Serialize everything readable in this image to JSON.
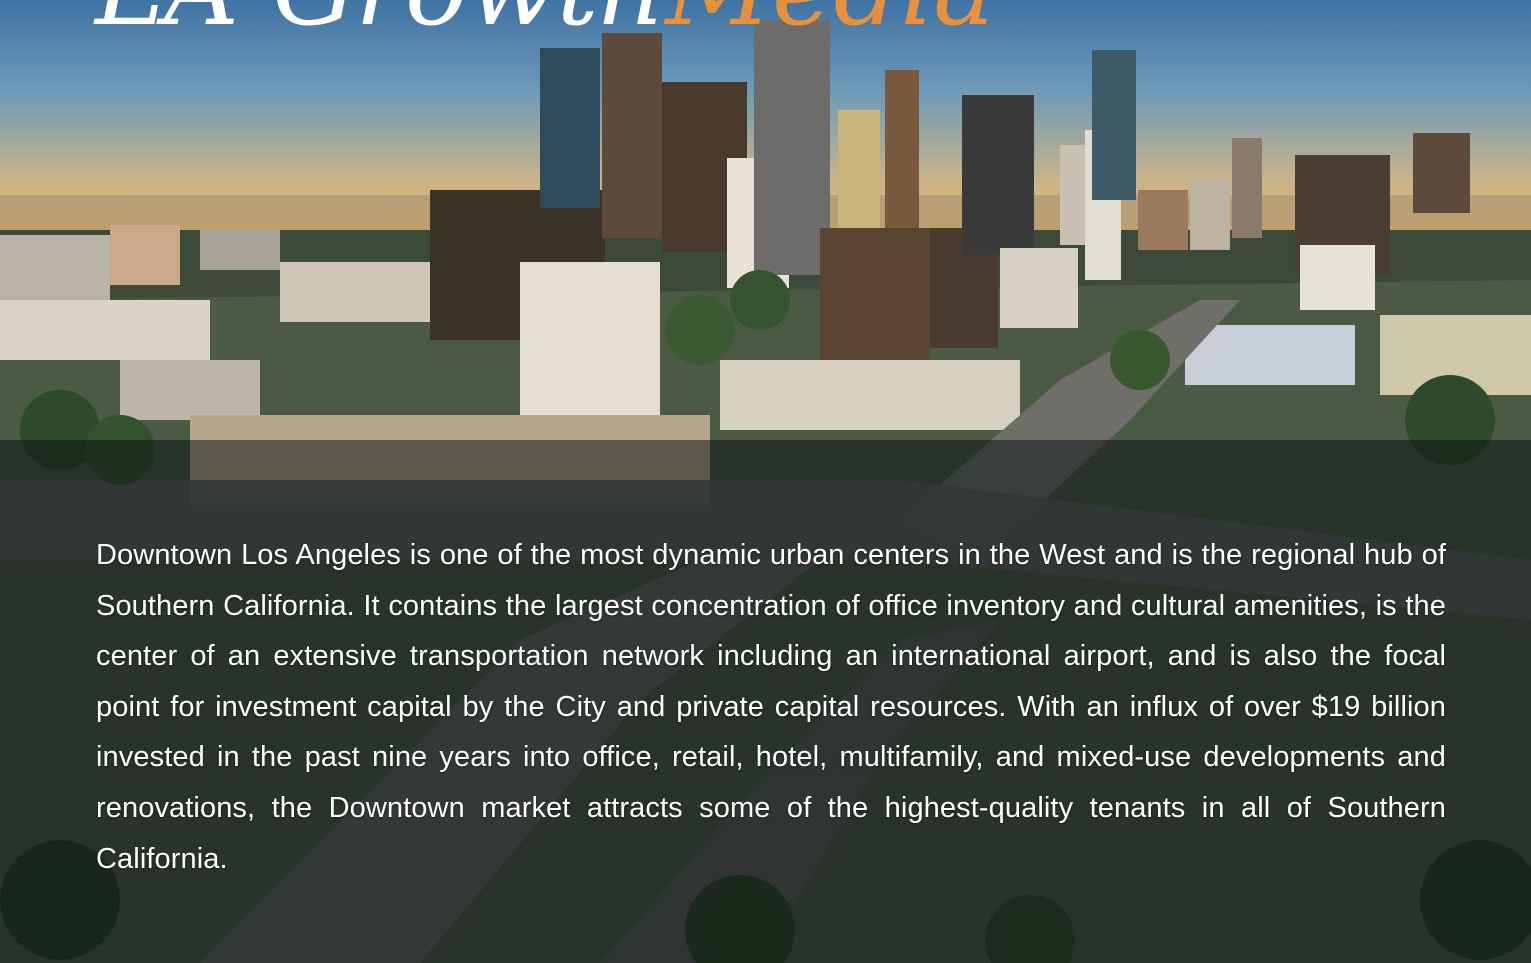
{
  "hero": {
    "image_icon": "downtown-los-angeles-aerial-photo",
    "title_white": "LA Growth",
    "title_accent": "Media",
    "accent_color": "#e8913c",
    "overlay_color": "rgba(10,18,20,0.52)"
  },
  "content": {
    "paragraph": "Downtown Los Angeles is one of the most dynamic urban centers in the West and is the regional hub of Southern California. It contains the largest concentration of office inventory and cultural amenities, is the center of an extensive transportation network including an international airport, and is also the focal point for investment capital by the City and private capital resources. With an influx of over $19 billion invested in the past nine years into office, retail, hotel, multifamily, and mixed-use developments and renovations, the Downtown market attracts some of the highest-quality tenants in all of Southern California."
  }
}
